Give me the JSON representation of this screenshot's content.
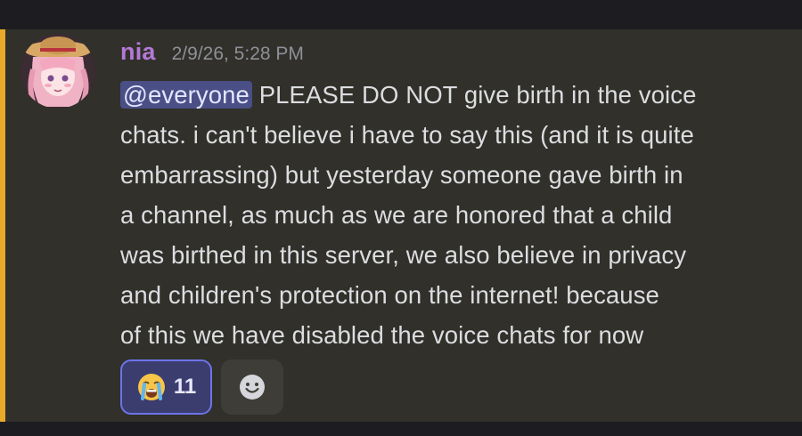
{
  "message": {
    "author": "nia",
    "timestamp": "2/9/26, 5:28 PM",
    "mention": "@everyone",
    "text_line1": " PLEASE DO NOT give birth in the voice",
    "text_line2": "chats. i can't believe i have to say this (and it is quite",
    "text_line3": "embarrassing) but yesterday someone gave birth in",
    "text_line4": "a channel, as much as we are honored that a child",
    "text_line5": "was birthed in this server, we also believe in privacy",
    "text_line6": "and children's protection on the internet! because",
    "text_line7": "of this we have disabled the voice chats for now",
    "highlight_color": "#e9a92b",
    "author_color": "#b479d6"
  },
  "reactions": [
    {
      "emoji": "loudly-crying-face-icon",
      "count": "11",
      "selected": true
    }
  ],
  "add_reaction_icon": "smiley-add-reaction-icon"
}
